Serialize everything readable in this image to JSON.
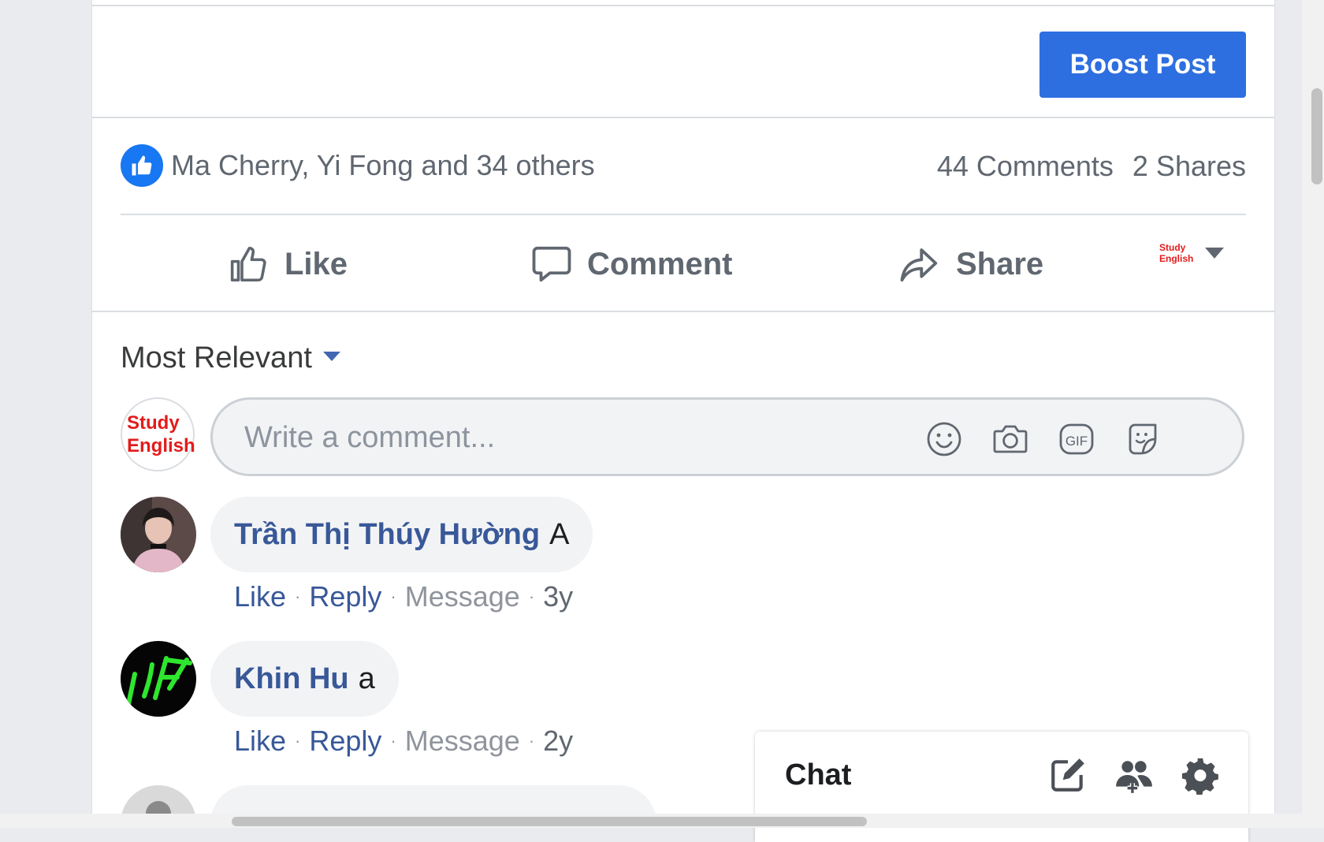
{
  "post": {
    "boost_label": "Boost Post",
    "reactions_text": "Ma Cherry, Yi Fong and 34 others",
    "comments_count": "44 Comments",
    "shares_count": "2 Shares",
    "actions": {
      "like": "Like",
      "comment": "Comment",
      "share": "Share"
    },
    "page_logo": [
      "Study",
      "English"
    ]
  },
  "comments_section": {
    "sort_label": "Most Relevant",
    "composer_placeholder": "Write a comment...",
    "self_avatar": [
      "Study",
      "English"
    ],
    "composer_icons": [
      "smiley-icon",
      "camera-icon",
      "gif-icon",
      "sticker-icon"
    ],
    "comments": [
      {
        "author": "Trần Thị Thúy Hường",
        "text": "A",
        "like": "Like",
        "reply": "Reply",
        "message": "Message",
        "age": "3y"
      },
      {
        "author": "Khin Hu",
        "text": "a",
        "like": "Like",
        "reply": "Reply",
        "message": "Message",
        "age": "2y"
      }
    ],
    "separator": "·"
  },
  "chat": {
    "title": "Chat",
    "icons": [
      "compose-icon",
      "new-group-icon",
      "settings-gear-icon"
    ]
  },
  "colors": {
    "brand_blue": "#2d6fe0",
    "link_blue": "#385898",
    "like_blue": "#1877f2",
    "logo_red": "#e31b1b"
  }
}
